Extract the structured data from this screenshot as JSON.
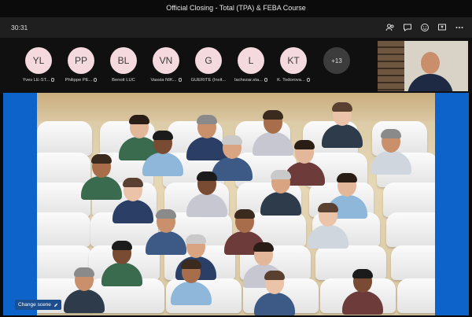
{
  "window": {
    "title": "Official Closing - Total (TPA) & FEBA Course"
  },
  "toolbar": {
    "timer": "30:31",
    "icons": [
      "people-icon",
      "chat-icon",
      "reactions-icon",
      "share-icon",
      "more-icon"
    ]
  },
  "participants": [
    {
      "initials": "YL",
      "name": "Yves LE-ST..."
    },
    {
      "initials": "PP",
      "name": "Philippe PE..."
    },
    {
      "initials": "BL",
      "name": "Benoit LUC"
    },
    {
      "initials": "VN",
      "name": "Vassia NIK..."
    },
    {
      "initials": "G",
      "name": "GUERITE (Invit..."
    },
    {
      "initials": "L",
      "name": "lachezar.sta..."
    },
    {
      "initials": "KT",
      "name": "K. Todorova..."
    }
  ],
  "overflow": {
    "label": "+13"
  },
  "scene": {
    "change_label": "Change scene"
  },
  "colors": {
    "accent": "#0d63c9",
    "avatar_bg": "#f4d9de",
    "titlebar": "#0b0b0b"
  }
}
